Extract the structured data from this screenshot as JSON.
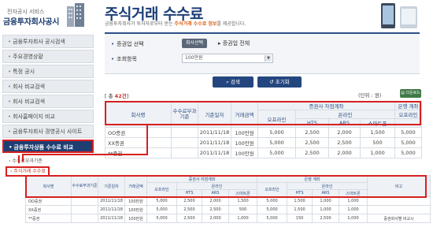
{
  "sidebar": {
    "subtitle": "전자공시 서비스",
    "title": "금융투자회사공시",
    "items": [
      {
        "label": "금융투자회사 공시검색"
      },
      {
        "label": "주요경영상황"
      },
      {
        "label": "특정 공시"
      },
      {
        "label": "회사 비교검색"
      },
      {
        "label": "회사 비교검색"
      },
      {
        "label": "회사홈페이지 비교"
      },
      {
        "label": "금융투자회사 경영공시 사이트"
      },
      {
        "label": "금융투자상품 수수료 비교"
      }
    ],
    "sub_items": [
      {
        "label": "수수료부과기준"
      },
      {
        "label": "주식거래 수수료"
      }
    ]
  },
  "header": {
    "title": "주식거래 수수료",
    "desc_pre": "금융투자회사가 투자자로부터 받는",
    "desc_hl": "주식거래 수수료 정보",
    "desc_post": "를 제공합니다."
  },
  "search": {
    "company_label": "증권업 선택",
    "company_btn": "회사선택",
    "company_value": "증권업 전체",
    "query_label": "조회항목",
    "query_value": "100만원",
    "search_btn": "검색",
    "reset_btn": "초기화"
  },
  "summary": {
    "total_pre": "[ 총",
    "total_count": "42건",
    "total_post": "]",
    "unit": "(단위 : 원)",
    "download": "다운로드"
  },
  "table": {
    "headers": {
      "company": "회사명",
      "fee_basis": "수수료부과기준",
      "base_date": "기준일자",
      "amount": "거래금액",
      "own_channel": "증권사 자점계좌",
      "bank_channel": "은행 계좌",
      "offline": "오프라인",
      "online": "온라인",
      "hts": "HTS",
      "ars": "ARS",
      "smartphone": "스마트폰",
      "note": "비고"
    },
    "rows": [
      {
        "company": "OO증권",
        "basis": "",
        "date": "2011/11/18",
        "amount": "100만원",
        "own_offline": "5,000",
        "own_hts": "2,500",
        "own_ars": "2,000",
        "own_smart": "1,500",
        "bank_offline": "5,000",
        "bank_hts": "1,500",
        "bank_ars": "1,000",
        "bank_smart": "1,000",
        "note": ""
      },
      {
        "company": "XX증권",
        "basis": "",
        "date": "2011/11/18",
        "amount": "100만원",
        "own_offline": "5,000",
        "own_hts": "2,500",
        "own_ars": "2,500",
        "own_smart": "500",
        "bank_offline": "5,000",
        "bank_hts": "1,500",
        "bank_ars": "1,000",
        "bank_smart": "1,000",
        "note": ""
      },
      {
        "company": "**증권",
        "basis": "",
        "date": "2011/11/18",
        "amount": "100만원",
        "own_offline": "5,000",
        "own_hts": "2,500",
        "own_ars": "2,000",
        "own_smart": "1,000",
        "bank_offline": "5,000",
        "bank_hts": "150",
        "bank_ars": "2,500",
        "bank_smart": "1,000",
        "note": "증권회사별 비교시"
      }
    ]
  }
}
